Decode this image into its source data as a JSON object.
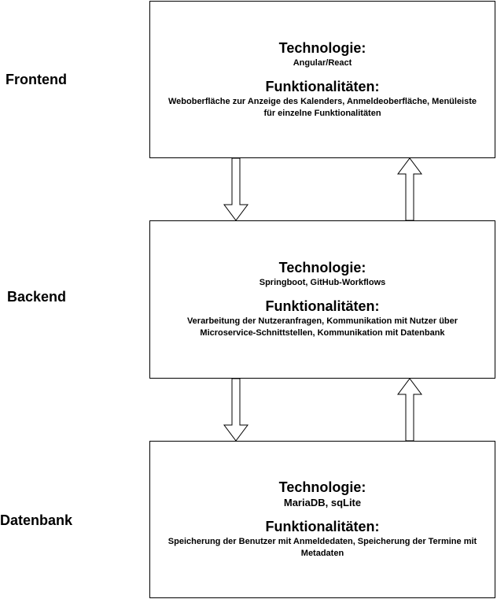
{
  "layers": [
    {
      "label": "Frontend",
      "tech_heading": "Technologie:",
      "tech_text": "Angular/React",
      "func_heading": "Funktionalitäten:",
      "func_text_lines": [
        "Weboberfläche zur Anzeige des Kalenders, Anmeldeoberfläche, Menüleiste",
        "für einzelne Funktionalitäten"
      ]
    },
    {
      "label": "Backend",
      "tech_heading": "Technologie:",
      "tech_text": "Springboot, GitHub-Workflows",
      "func_heading": "Funktionalitäten:",
      "func_text_lines": [
        "Verarbeitung der Nutzeranfragen, Kommunikation mit Nutzer über",
        "Microservice-Schnittstellen, Kommunikation mit Datenbank"
      ]
    },
    {
      "label": "Datenbank",
      "tech_heading": "Technologie:",
      "tech_text": "MariaDB, sqLite",
      "func_heading": "Funktionalitäten:",
      "func_text_lines": [
        "Speicherung der Benutzer mit Anmeldedaten, Speicherung der Termine mit",
        "Metadaten"
      ]
    }
  ],
  "connections": [
    {
      "from": "Frontend",
      "to": "Backend"
    },
    {
      "from": "Backend",
      "to": "Frontend"
    },
    {
      "from": "Backend",
      "to": "Datenbank"
    },
    {
      "from": "Datenbank",
      "to": "Backend"
    }
  ]
}
